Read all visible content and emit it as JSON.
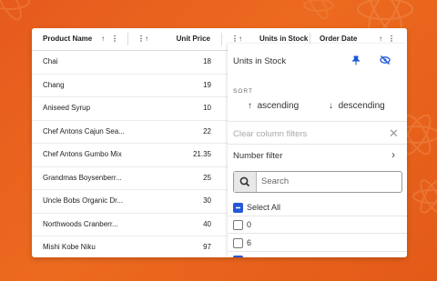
{
  "grid": {
    "columns": {
      "product_name": "Product Name",
      "unit_price": "Unit Price",
      "units_in_stock": "Units in Stock",
      "order_date": "Order Date"
    },
    "rows": [
      {
        "name": "Chai",
        "price": "18"
      },
      {
        "name": "Chang",
        "price": "19"
      },
      {
        "name": "Aniseed Syrup",
        "price": "10"
      },
      {
        "name": "Chef Antons Cajun Sea...",
        "price": "22"
      },
      {
        "name": "Chef Antons Gumbo Mix",
        "price": "21.35"
      },
      {
        "name": "Grandmas Boysenberr...",
        "price": "25"
      },
      {
        "name": "Uncle Bobs Organic Dr...",
        "price": "30"
      },
      {
        "name": "Northwoods Cranberr...",
        "price": "40"
      },
      {
        "name": "Mishi Kobe Niku",
        "price": "97"
      }
    ]
  },
  "panel": {
    "title": "Units in Stock",
    "sort_label": "SORT",
    "ascending": "ascending",
    "descending": "descending",
    "clear_filters": "Clear column filters",
    "number_filter": "Number filter",
    "search_placeholder": "Search",
    "options": [
      {
        "label": "Select All",
        "checked": true
      },
      {
        "label": "0",
        "checked": false
      },
      {
        "label": "6",
        "checked": false
      }
    ]
  },
  "colors": {
    "accent": "#2557d6",
    "background": "#e8601c"
  },
  "icons": {
    "sort": "arrow-up-icon",
    "menu": "vertical-dots-icon",
    "pin": "pin-icon",
    "hide": "eye-off-icon",
    "search": "search-icon",
    "clear": "close-icon",
    "expand": "chevron-right-icon",
    "decoration": "react-atom-icon"
  }
}
